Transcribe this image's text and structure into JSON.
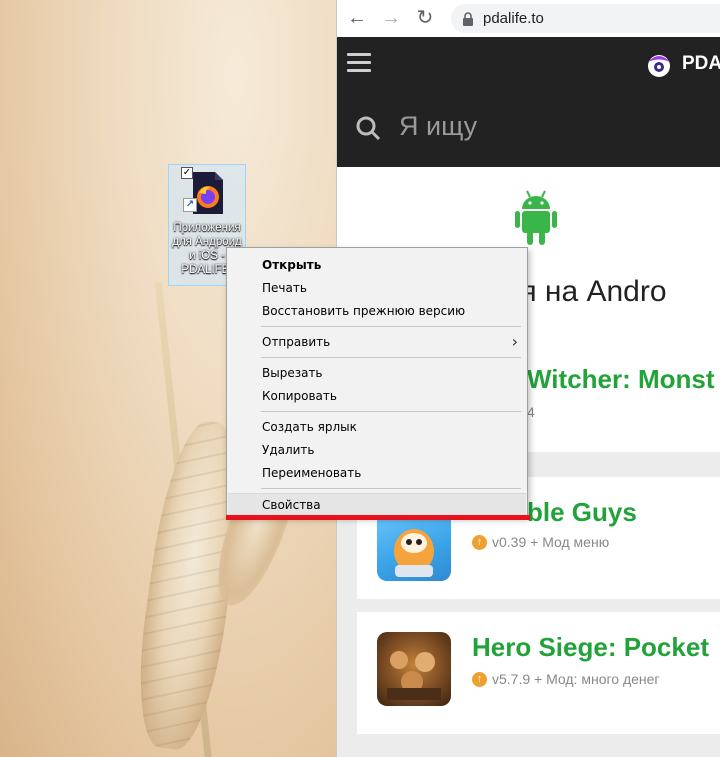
{
  "desktop": {
    "icon": {
      "label": "Приложения\nдля Андроид\nи iOS -\nPDALIFE.",
      "checked": true
    }
  },
  "browser": {
    "url": "pdalife.to",
    "site": {
      "logo_text": "PDAL",
      "search_placeholder": "Я ищу",
      "section_title": "ния на Andro",
      "apps": [
        {
          "title": "Witcher: Monst",
          "meta": "4"
        },
        {
          "title": "ble Guys",
          "meta": "v0.39 + Мод меню"
        },
        {
          "title": "Hero Siege: Pocket",
          "meta": "v5.7.9 + Мод: много денег"
        }
      ],
      "colors": {
        "accent_green": "#22a33a",
        "header_bg": "#222222"
      }
    }
  },
  "context_menu": {
    "items": [
      {
        "label": "Открыть"
      },
      {
        "label": "Печать"
      },
      {
        "label": "Восстановить прежнюю версию"
      },
      {
        "label": "Отправить"
      },
      {
        "label": "Вырезать"
      },
      {
        "label": "Копировать"
      },
      {
        "label": "Создать ярлык"
      },
      {
        "label": "Удалить"
      },
      {
        "label": "Переименовать"
      },
      {
        "label": "Свойства"
      }
    ],
    "highlight_color": "#e8101a"
  }
}
